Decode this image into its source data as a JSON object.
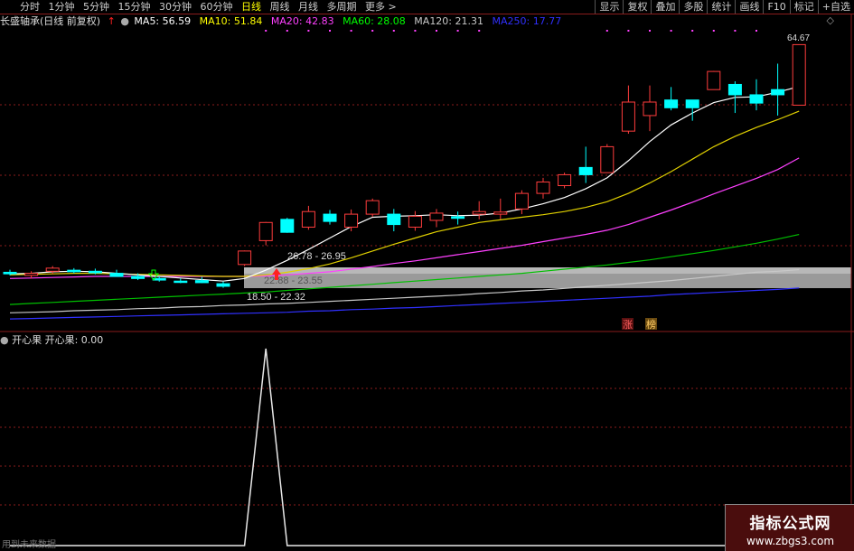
{
  "toolbar": {
    "periods": [
      "分时",
      "1分钟",
      "5分钟",
      "15分钟",
      "30分钟",
      "60分钟",
      "日线",
      "周线",
      "月线",
      "多周期",
      "更多 >"
    ],
    "active": "日线",
    "right": [
      "显示",
      "复权",
      "叠加",
      "多股",
      "统计",
      "画线",
      "F10",
      "标记",
      "+自选"
    ]
  },
  "info": {
    "title": "长盛轴承(日线 前复权)",
    "ma": [
      {
        "label": "MA5: 56.59",
        "color": "#ffffff"
      },
      {
        "label": "MA10: 51.84",
        "color": "#ffff00"
      },
      {
        "label": "MA20: 42.83",
        "color": "#ff40ff"
      },
      {
        "label": "MA60: 28.08",
        "color": "#00ff00"
      },
      {
        "label": "MA120: 21.31",
        "color": "#c8c8c8"
      },
      {
        "label": "MA250: 17.77",
        "color": "#3030ff"
      }
    ]
  },
  "main_labels": {
    "high": "64.67",
    "box_top": "26.78 - 26.95",
    "box_mid": "22.88 - 23.55",
    "box_low": "18.50 - 22.32",
    "tag_zhang": "涨",
    "tag_bang": "榜"
  },
  "sub": {
    "title": "开心果",
    "value": "开心果: 0.00",
    "note": "用到未来数据"
  },
  "watermark": {
    "line1": "指标公式网",
    "line2": "www.zbgs3.com"
  },
  "colors": {
    "up": "#ff3c3c",
    "down": "#00ffff",
    "grid": "#8a1c1c"
  },
  "chart_data": {
    "type": "candlestick",
    "price_range": [
      12,
      67
    ],
    "candles": [
      {
        "o": 20.8,
        "h": 21.3,
        "l": 20.2,
        "c": 20.5
      },
      {
        "o": 20.2,
        "h": 21.0,
        "l": 19.6,
        "c": 20.6
      },
      {
        "o": 21.0,
        "h": 22.0,
        "l": 20.5,
        "c": 21.6
      },
      {
        "o": 21.2,
        "h": 21.6,
        "l": 20.6,
        "c": 20.9
      },
      {
        "o": 21.0,
        "h": 21.5,
        "l": 20.4,
        "c": 20.7
      },
      {
        "o": 20.6,
        "h": 21.3,
        "l": 20.0,
        "c": 20.0
      },
      {
        "o": 20.0,
        "h": 20.6,
        "l": 19.3,
        "c": 19.6
      },
      {
        "o": 19.6,
        "h": 20.0,
        "l": 19.0,
        "c": 19.3
      },
      {
        "o": 19.1,
        "h": 19.6,
        "l": 18.7,
        "c": 18.9
      },
      {
        "o": 19.2,
        "h": 19.9,
        "l": 18.7,
        "c": 18.8
      },
      {
        "o": 18.6,
        "h": 19.0,
        "l": 17.8,
        "c": 18.1
      },
      {
        "o": 22.3,
        "h": 25.0,
        "l": 22.0,
        "c": 24.9
      },
      {
        "o": 26.9,
        "h": 30.5,
        "l": 26.0,
        "c": 30.4
      },
      {
        "o": 31.0,
        "h": 31.3,
        "l": 28.4,
        "c": 28.5
      },
      {
        "o": 29.5,
        "h": 33.6,
        "l": 29.0,
        "c": 32.5
      },
      {
        "o": 32.0,
        "h": 32.8,
        "l": 30.0,
        "c": 30.6
      },
      {
        "o": 29.5,
        "h": 32.9,
        "l": 28.7,
        "c": 32.0
      },
      {
        "o": 32.0,
        "h": 35.0,
        "l": 31.5,
        "c": 34.6
      },
      {
        "o": 32.0,
        "h": 33.0,
        "l": 28.7,
        "c": 30.0
      },
      {
        "o": 29.5,
        "h": 32.6,
        "l": 28.8,
        "c": 31.6
      },
      {
        "o": 30.8,
        "h": 33.0,
        "l": 29.5,
        "c": 32.2
      },
      {
        "o": 31.5,
        "h": 32.5,
        "l": 30.0,
        "c": 31.2
      },
      {
        "o": 32.0,
        "h": 34.5,
        "l": 31.0,
        "c": 32.5
      },
      {
        "o": 32.0,
        "h": 35.0,
        "l": 31.0,
        "c": 32.4
      },
      {
        "o": 33.0,
        "h": 36.6,
        "l": 32.0,
        "c": 36.0
      },
      {
        "o": 36.0,
        "h": 39.0,
        "l": 35.0,
        "c": 38.2
      },
      {
        "o": 37.5,
        "h": 40.0,
        "l": 37.0,
        "c": 39.6
      },
      {
        "o": 41.0,
        "h": 45.0,
        "l": 38.0,
        "c": 39.6
      },
      {
        "o": 40.0,
        "h": 45.5,
        "l": 40.0,
        "c": 45.0
      },
      {
        "o": 48.0,
        "h": 56.8,
        "l": 47.5,
        "c": 53.6
      },
      {
        "o": 51.0,
        "h": 56.8,
        "l": 48.0,
        "c": 53.6
      },
      {
        "o": 54.0,
        "h": 56.5,
        "l": 52.0,
        "c": 52.5
      },
      {
        "o": 54.0,
        "h": 54.0,
        "l": 50.0,
        "c": 52.5
      },
      {
        "o": 56.0,
        "h": 59.6,
        "l": 56.0,
        "c": 59.5
      },
      {
        "o": 57.0,
        "h": 57.6,
        "l": 51.5,
        "c": 55.0
      },
      {
        "o": 55.0,
        "h": 58.0,
        "l": 52.0,
        "c": 53.4
      },
      {
        "o": 56.0,
        "h": 61.0,
        "l": 51.0,
        "c": 55.0
      },
      {
        "o": 53.0,
        "h": 64.67,
        "l": 53.0,
        "c": 64.67
      }
    ],
    "ma5": [
      20.5,
      20.6,
      20.9,
      21.0,
      20.9,
      20.6,
      20.3,
      20.0,
      19.7,
      19.4,
      19.1,
      19.6,
      21.2,
      23.1,
      25.2,
      27.4,
      29.6,
      31.4,
      31.6,
      31.7,
      31.9,
      31.7,
      31.8,
      32.2,
      33.0,
      34.0,
      35.2,
      36.9,
      39.0,
      42.3,
      46.0,
      49.2,
      51.5,
      53.5,
      54.5,
      54.6,
      55.5,
      56.59
    ],
    "ma10": [
      20.3,
      20.4,
      20.5,
      20.6,
      20.6,
      20.5,
      20.4,
      20.3,
      20.2,
      20.1,
      20.0,
      20.0,
      20.3,
      20.8,
      21.5,
      22.4,
      23.6,
      24.9,
      26.2,
      27.4,
      28.6,
      29.5,
      30.4,
      30.9,
      31.4,
      31.9,
      32.5,
      33.3,
      34.4,
      36.0,
      38.0,
      40.2,
      42.6,
      45.0,
      47.0,
      48.7,
      50.2,
      51.84
    ],
    "ma20": [
      19.6,
      19.7,
      19.8,
      19.9,
      20.0,
      20.0,
      20.0,
      20.0,
      20.0,
      20.0,
      20.0,
      20.0,
      20.1,
      20.3,
      20.6,
      20.9,
      21.4,
      21.9,
      22.5,
      23.0,
      23.6,
      24.2,
      24.8,
      25.4,
      26.0,
      26.7,
      27.4,
      28.1,
      28.9,
      30.0,
      31.4,
      32.8,
      34.3,
      35.9,
      37.4,
      38.9,
      40.6,
      42.83
    ],
    "ma60": [
      14.6,
      14.8,
      15.0,
      15.2,
      15.4,
      15.6,
      15.8,
      16.0,
      16.2,
      16.4,
      16.6,
      16.8,
      17.0,
      17.3,
      17.6,
      17.9,
      18.2,
      18.5,
      18.8,
      19.1,
      19.4,
      19.7,
      20.0,
      20.3,
      20.6,
      21.0,
      21.4,
      21.8,
      22.2,
      22.7,
      23.2,
      23.8,
      24.4,
      25.0,
      25.7,
      26.4,
      27.2,
      28.08
    ],
    "ma120": [
      13.0,
      13.1,
      13.2,
      13.4,
      13.5,
      13.6,
      13.8,
      13.9,
      14.1,
      14.2,
      14.4,
      14.5,
      14.7,
      14.8,
      15.0,
      15.2,
      15.4,
      15.6,
      15.8,
      16.0,
      16.2,
      16.4,
      16.7,
      16.9,
      17.2,
      17.4,
      17.7,
      18.0,
      18.3,
      18.6,
      18.9,
      19.2,
      19.6,
      20.0,
      20.4,
      20.8,
      21.0,
      21.31
    ],
    "ma250": [
      11.8,
      11.9,
      12.0,
      12.1,
      12.2,
      12.3,
      12.4,
      12.5,
      12.6,
      12.7,
      12.8,
      12.9,
      13.0,
      13.1,
      13.3,
      13.4,
      13.6,
      13.7,
      13.9,
      14.0,
      14.2,
      14.4,
      14.6,
      14.8,
      15.0,
      15.2,
      15.4,
      15.6,
      15.8,
      16.0,
      16.2,
      16.5,
      16.7,
      16.9,
      17.1,
      17.3,
      17.5,
      17.77
    ],
    "indicator": [
      0,
      0,
      0,
      0,
      0,
      0,
      0,
      0,
      0,
      0,
      0,
      0,
      1,
      0,
      0,
      0,
      0,
      0,
      0,
      0,
      0,
      0,
      0,
      0,
      0,
      0,
      0,
      0,
      0,
      0,
      0,
      0,
      0,
      0,
      0,
      0,
      0,
      0
    ]
  }
}
